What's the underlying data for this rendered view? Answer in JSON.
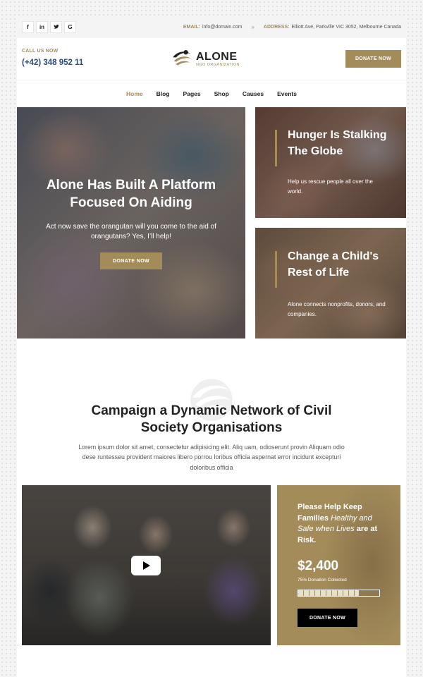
{
  "topbar": {
    "social": [
      {
        "icon": "facebook-icon",
        "glyph": "f"
      },
      {
        "icon": "linkedin-icon",
        "glyph": "in"
      },
      {
        "icon": "twitter-icon",
        "glyph": "🐦"
      },
      {
        "icon": "google-icon",
        "glyph": "G"
      }
    ],
    "email_label": "EMAIL:",
    "email": "info@domain.com",
    "separator": "»",
    "address_label": "ADDRESS:",
    "address": "Elliott Ave, Parkville VIC 3052, Melbourne Canada"
  },
  "header": {
    "call_label": "CALL US NOW",
    "phone": "(+42) 348 952 11",
    "logo_name": "ALONE",
    "logo_tagline": "NGO ORGANIZATION",
    "donate_label": "DONATE NOW"
  },
  "nav": {
    "items": [
      {
        "label": "Home",
        "active": true
      },
      {
        "label": "Blog"
      },
      {
        "label": "Pages"
      },
      {
        "label": "Shop"
      },
      {
        "label": "Causes"
      },
      {
        "label": "Events"
      }
    ]
  },
  "hero": {
    "title": "Alone Has Built A Platform Focused On Aiding",
    "subtitle": "Act now save the orangutan will you come to the aid of orangutans? Yes, I’ll help!",
    "button_label": "DONATE NOW"
  },
  "cards": [
    {
      "title": "Hunger Is Stalking The Globe",
      "text": "Help us rescue people all over the world."
    },
    {
      "title": "Change a Child's Rest of Life",
      "text": "Alone connects nonprofits, donors, and companies."
    }
  ],
  "campaign": {
    "title": "Campaign a Dynamic Network of Civil Society Organisations",
    "text": "Lorem ipsum dolor sit amet, consectetur adipisicing elit. Aliq uam, odioserunt provin Aliquam odio dese runtesseu provident maiores libero porrou loribus officia aspernat error incidunt excepturi doloribus officia"
  },
  "video": {
    "play_icon": "play-icon"
  },
  "donation": {
    "title_part1": "Please Help Keep Families",
    "title_part2": "Healthy and Safe when Lives",
    "title_part3": "are at Risk.",
    "amount": "$2,400",
    "collected_text": "75% Donation Collected",
    "progress_fraction": 0.75,
    "button_label": "DONATE NOW"
  },
  "colors": {
    "accent": "#a38c5a",
    "phone": "#2b4a7e",
    "dark": "#222222"
  }
}
